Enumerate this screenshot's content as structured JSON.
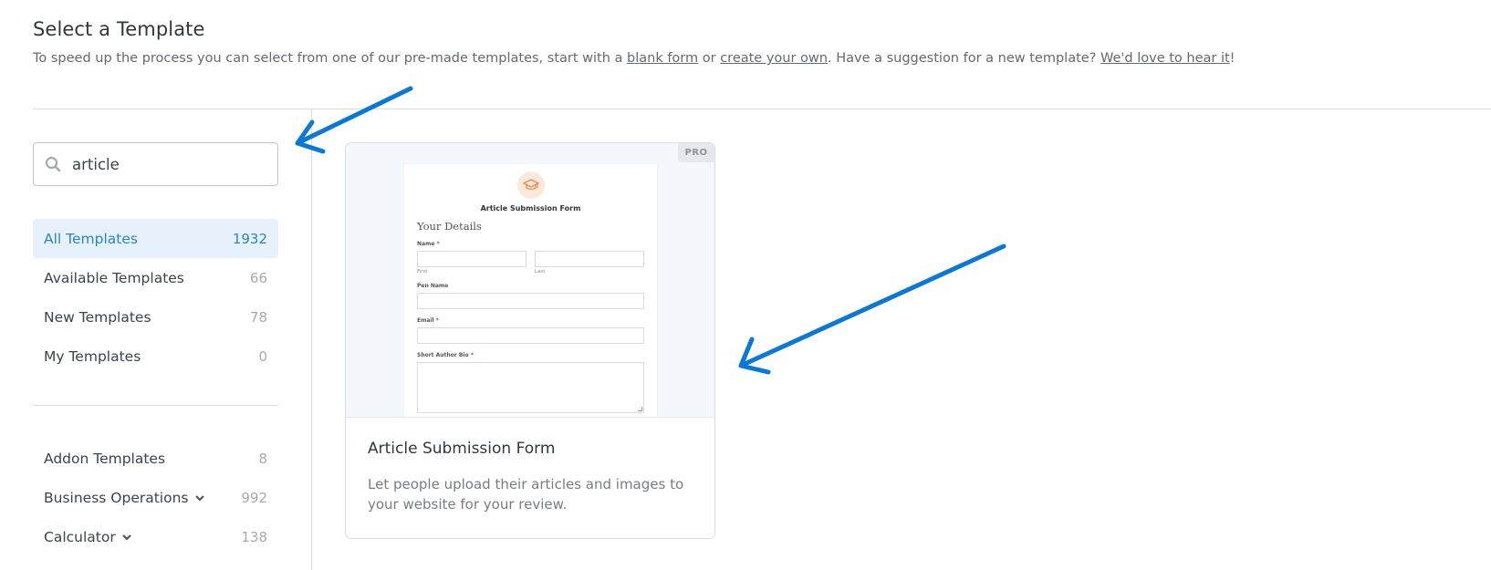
{
  "header": {
    "title": "Select a Template",
    "desc_prefix": "To speed up the process you can select from one of our pre-made templates, start with a ",
    "link_blank_form": "blank form",
    "desc_or": " or ",
    "link_create_own": "create your own",
    "desc_suggest": ". Have a suggestion for a new template? ",
    "link_hear_it": "We'd love to hear it",
    "desc_suffix": "!"
  },
  "search": {
    "value": "article",
    "icon": "search-icon"
  },
  "categories_primary": [
    {
      "label": "All Templates",
      "count": "1932",
      "active": true
    },
    {
      "label": "Available Templates",
      "count": "66"
    },
    {
      "label": "New Templates",
      "count": "78"
    },
    {
      "label": "My Templates",
      "count": "0"
    }
  ],
  "categories_secondary": [
    {
      "label": "Addon Templates",
      "count": "8",
      "expandable": false
    },
    {
      "label": "Business Operations",
      "count": "992",
      "expandable": true
    },
    {
      "label": "Calculator",
      "count": "138",
      "expandable": true
    }
  ],
  "template_card": {
    "badge": "PRO",
    "title": "Article Submission Form",
    "description": "Let people upload their articles and images to your website for your review.",
    "preview": {
      "icon": "graduation-cap-icon",
      "form_title": "Article Submission Form",
      "section_title": "Your Details",
      "name_label": "Name",
      "first_sublabel": "First",
      "last_sublabel": "Last",
      "pen_name_label": "Pen Name",
      "email_label": "Email",
      "bio_label": "Short Author Bio",
      "required_mark": "*"
    }
  },
  "colors": {
    "accent": "#2a86c6",
    "active_bg": "#e6f1fb",
    "annotation_arrow": "#0b78d6",
    "preview_icon": "#e9894d"
  }
}
